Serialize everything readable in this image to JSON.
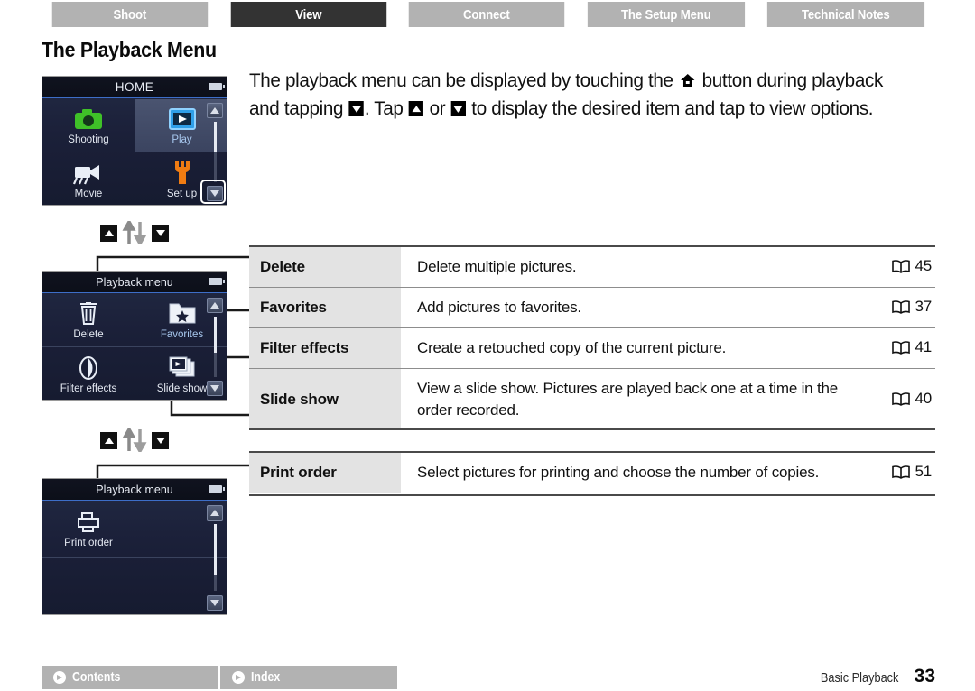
{
  "tabs": [
    {
      "label": "Shoot",
      "active": false
    },
    {
      "label": "View",
      "active": true
    },
    {
      "label": "Connect",
      "active": false
    },
    {
      "label": "The Setup Menu",
      "active": false
    },
    {
      "label": "Technical Notes",
      "active": false
    }
  ],
  "page_title": "The Playback Menu",
  "intro": {
    "part1": "The playback menu can be displayed by touching the ",
    "part2": " button during playback and tapping ",
    "part3": ". Tap ",
    "part4": " or ",
    "part5": " to display the desired item and tap to view options."
  },
  "screens": [
    {
      "title": "HOME",
      "items": [
        {
          "label": "Shooting",
          "icon": "camera-icon",
          "selected": false
        },
        {
          "label": "Play",
          "icon": "play-icon",
          "selected": true
        },
        {
          "label": "Movie",
          "icon": "movie-camera-icon",
          "selected": false
        },
        {
          "label": "Set up",
          "icon": "wrench-icon",
          "selected": false
        }
      ]
    },
    {
      "title": "Playback menu",
      "items": [
        {
          "label": "Delete",
          "icon": "trash-icon",
          "selected": false
        },
        {
          "label": "Favorites",
          "icon": "favorites-folder-icon",
          "selected": false
        },
        {
          "label": "Filter effects",
          "icon": "filter-effects-icon",
          "selected": false
        },
        {
          "label": "Slide show",
          "icon": "slide-show-icon",
          "selected": false
        }
      ]
    },
    {
      "title": "Playback menu",
      "items": [
        {
          "label": "Print order",
          "icon": "printer-icon",
          "selected": false
        }
      ]
    }
  ],
  "table": {
    "rows": [
      {
        "name": "Delete",
        "desc": "Delete multiple pictures.",
        "page": "45"
      },
      {
        "name": "Favorites",
        "desc": "Add pictures to favorites.",
        "page": "37"
      },
      {
        "name": "Filter effects",
        "desc": "Create a retouched copy of the current picture.",
        "page": "41"
      },
      {
        "name": "Slide show",
        "desc": "View a slide show. Pictures are played back one at a time in the order recorded.",
        "page": "40"
      },
      {
        "name": "Print order",
        "desc": "Select pictures for printing and choose the number of copies.",
        "page": "51"
      }
    ]
  },
  "footer": {
    "contents_label": "Contents",
    "index_label": "Index",
    "section": "Basic Playback",
    "page_number": "33"
  },
  "colors": {
    "tab_inactive": "#b2b2b2",
    "tab_active": "#333333",
    "screen_bg": "#1b2039",
    "table_name_bg": "#e3e3e3",
    "accent_green": "#3fc128",
    "accent_blue": "#2f9fe8",
    "accent_orange": "#f07c12"
  }
}
